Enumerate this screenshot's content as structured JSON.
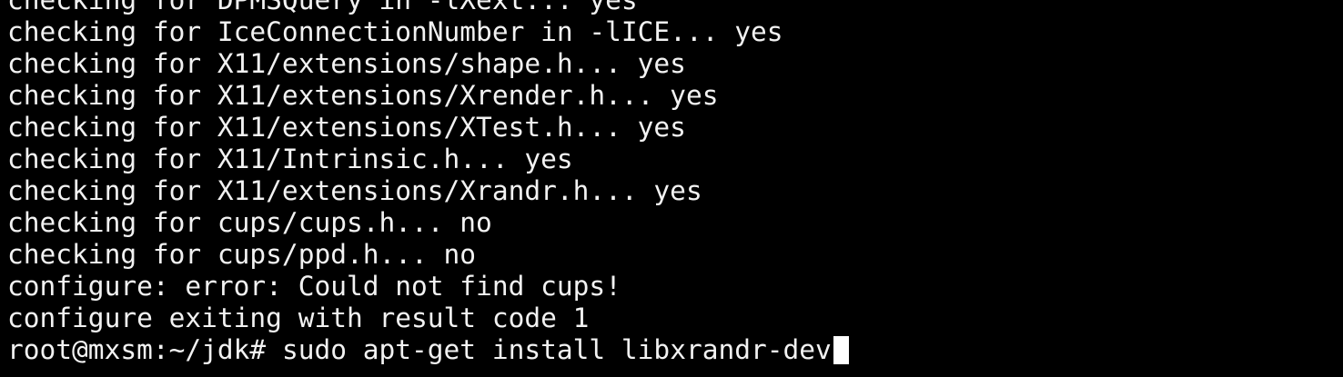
{
  "terminal": {
    "output_lines": [
      "checking for DPMSQuery in -lXext... yes",
      "checking for IceConnectionNumber in -lICE... yes",
      "checking for X11/extensions/shape.h... yes",
      "checking for X11/extensions/Xrender.h... yes",
      "checking for X11/extensions/XTest.h... yes",
      "checking for X11/Intrinsic.h... yes",
      "checking for X11/extensions/Xrandr.h... yes",
      "checking for cups/cups.h... no",
      "checking for cups/ppd.h... no",
      "configure: error: Could not find cups!",
      "configure exiting with result code 1"
    ],
    "prompt": "root@mxsm:~/jdk# ",
    "command": "sudo apt-get install libxrandr-dev",
    "colors": {
      "background": "#000000",
      "foreground": "#f2f2f2",
      "cursor": "#ffffff"
    }
  }
}
